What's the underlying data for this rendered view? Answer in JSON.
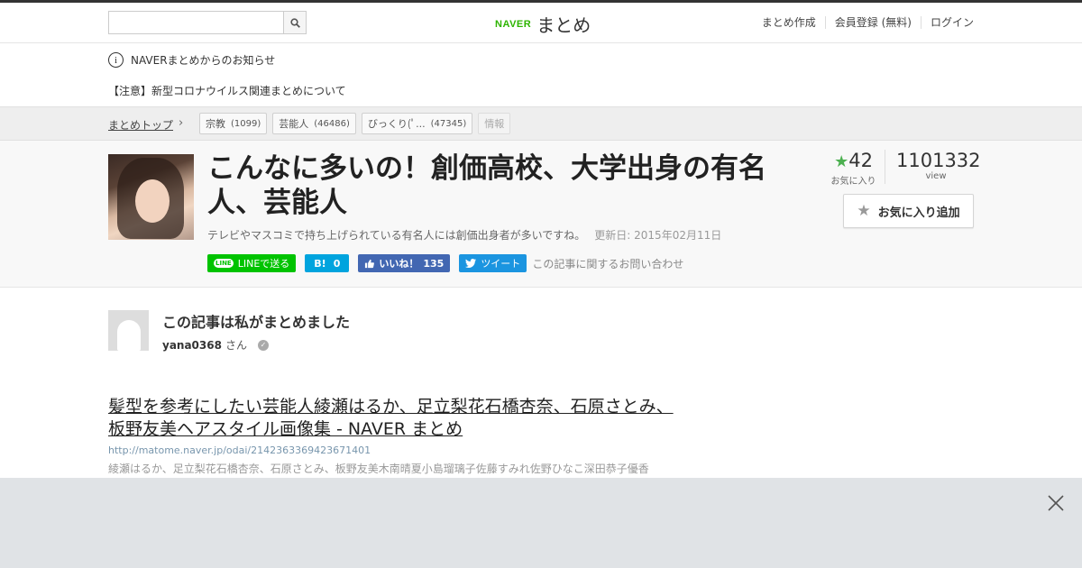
{
  "header": {
    "search_placeholder": "",
    "logo_brand": "NAVER",
    "logo_text": "まとめ",
    "links": [
      "まとめ作成",
      "会員登録 (無料)",
      "ログイン"
    ]
  },
  "notice": {
    "title": "NAVERまとめからのお知らせ",
    "message": "【注意】新型コロナウイルス関連まとめについて"
  },
  "breadcrumb": {
    "home": "まとめトップ",
    "tags": [
      {
        "label": "宗教",
        "count": "(1099)"
      },
      {
        "label": "芸能人",
        "count": "(46486)"
      },
      {
        "label": "びっくり(ﾟ...",
        "count": "(47345)"
      },
      {
        "label": "情報",
        "count": ""
      }
    ]
  },
  "article": {
    "title": "こんなに多いの！創価高校、大学出身の有名人、芸能人",
    "description": "テレビやマスコミで持ち上げられている有名人には創価出身者が多いですね。",
    "updated": "更新日: 2015年02月11日",
    "favorites": "42",
    "favorites_label": "お気に入り",
    "views": "1101332",
    "views_label": "view",
    "fav_add_label": "お気に入り追加"
  },
  "share": {
    "line_icon": "LINE",
    "line_label": "LINEで送る",
    "hatena_label": "B!",
    "hatena_count": "0",
    "fb_label": "いいね！",
    "fb_count": "135",
    "tw_label": "ツイート",
    "inquiry": "この記事に関するお問い合わせ"
  },
  "author": {
    "heading": "この記事は私がまとめました",
    "name": "yana0368",
    "suffix": "さん"
  },
  "link_card": {
    "title": "髪型を参考にしたい芸能人綾瀬はるか、足立梨花石橋杏奈、石原さとみ、板野友美ヘアスタイル画像集 - NAVER まとめ",
    "url": "http://matome.naver.jp/odai/2142363369423671401",
    "description": "綾瀬はるか、足立梨花石橋杏奈、石原さとみ、板野友美木南晴夏小島瑠璃子佐藤すみれ佐野ひなこ深田恭子優香"
  },
  "colors": {
    "accent_green": "#2db400",
    "line_green": "#00c300",
    "hatena_blue": "#00a4de",
    "facebook_blue": "#4267b2",
    "twitter_blue": "#1b95e0",
    "star_green": "#4cb050"
  }
}
